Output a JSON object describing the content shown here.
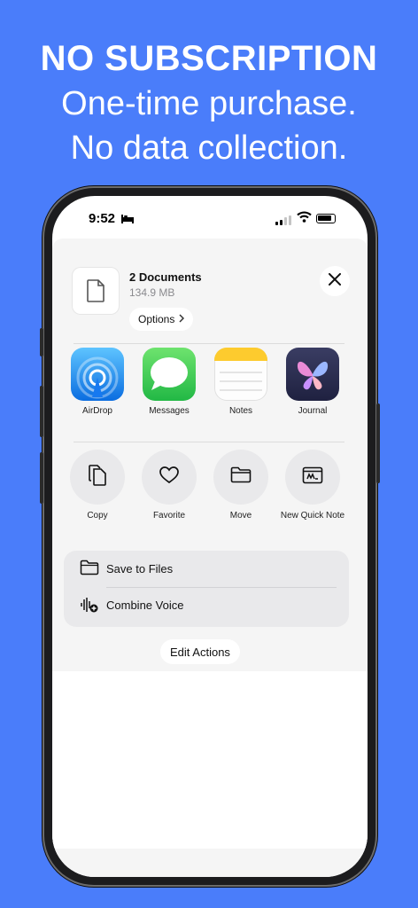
{
  "marketing": {
    "headline": "NO SUBSCRIPTION",
    "line1": "One-time purchase.",
    "line2": "No data collection."
  },
  "status_bar": {
    "time": "9:52",
    "focus_icon": "bed-icon",
    "signal_icon": "cellular-icon",
    "wifi_icon": "wifi-icon",
    "battery_icon": "battery-icon"
  },
  "share_sheet": {
    "document": {
      "title": "2 Documents",
      "size": "134.9 MB",
      "thumbnail_icon": "document-icon"
    },
    "options_label": "Options",
    "close_icon": "close-icon",
    "apps": [
      {
        "label": "AirDrop",
        "icon": "airdrop-icon",
        "color": "#1e8cf5"
      },
      {
        "label": "Messages",
        "icon": "messages-icon",
        "color": "#34c759"
      },
      {
        "label": "Notes",
        "icon": "notes-icon",
        "color": "#ffd60a"
      },
      {
        "label": "Journal",
        "icon": "journal-icon",
        "color": "#2b2d4e"
      }
    ],
    "actions": [
      {
        "label": "Copy",
        "icon": "copy-icon"
      },
      {
        "label": "Favorite",
        "icon": "heart-icon"
      },
      {
        "label": "Move",
        "icon": "folder-icon"
      },
      {
        "label": "New Quick Note",
        "icon": "quick-note-icon"
      }
    ],
    "list_actions": [
      {
        "label": "Save to Files",
        "icon": "folder-icon"
      },
      {
        "label": "Combine Voice",
        "icon": "waveform-add-icon"
      }
    ],
    "edit_actions_label": "Edit Actions"
  },
  "colors": {
    "background": "#4a7dfa",
    "sheet": "#f5f5f5"
  }
}
